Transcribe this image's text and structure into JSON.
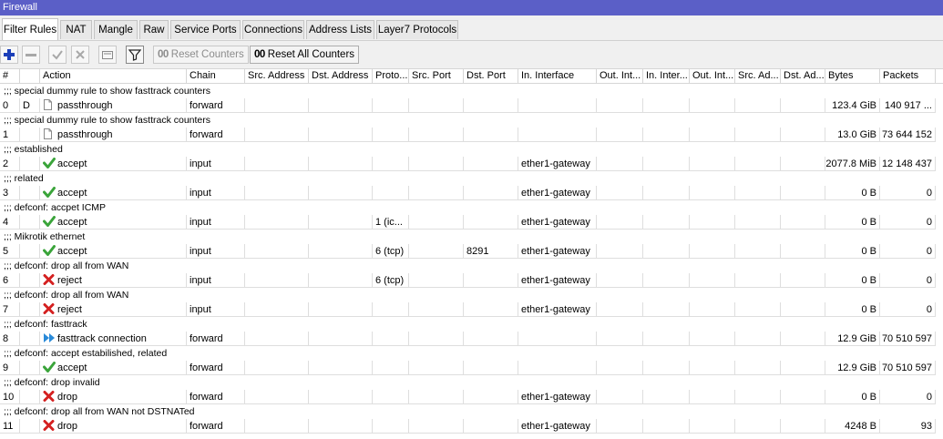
{
  "window": {
    "title": "Firewall"
  },
  "tabs": [
    {
      "label": "Filter Rules",
      "active": true
    },
    {
      "label": "NAT"
    },
    {
      "label": "Mangle"
    },
    {
      "label": "Raw"
    },
    {
      "label": "Service Ports"
    },
    {
      "label": "Connections"
    },
    {
      "label": "Address Lists"
    },
    {
      "label": "Layer7 Protocols"
    }
  ],
  "toolbar": {
    "reset_counters": "Reset Counters",
    "reset_all_counters": "Reset All Counters",
    "counter_badge": "00"
  },
  "columns": [
    "#",
    "",
    "Action",
    "Chain",
    "Src. Address",
    "Dst. Address",
    "Proto...",
    "Src. Port",
    "Dst. Port",
    "In. Interface",
    "Out. Int...",
    "In. Inter...",
    "Out. Int...",
    "Src. Ad...",
    "Dst. Ad...",
    "Bytes",
    "Packets"
  ],
  "colors": {
    "title_bar": "#5b5fc7",
    "accept": "#3aa43a",
    "reject": "#d42020",
    "fasttrack": "#2a8ad8"
  },
  "rows": [
    {
      "comment": ";;; special dummy rule to show fasttrack counters",
      "num": "0",
      "flag": "D",
      "action": "passthrough",
      "action_icon": "doc-icon",
      "chain": "forward",
      "src_address": "",
      "dst_address": "",
      "protocol": "",
      "src_port": "",
      "dst_port": "",
      "in_interface": "",
      "bytes": "123.4 GiB",
      "packets": "140 917 ..."
    },
    {
      "comment": ";;; special dummy rule to show fasttrack counters",
      "num": "1",
      "flag": "",
      "action": "passthrough",
      "action_icon": "doc-icon",
      "chain": "forward",
      "src_address": "",
      "dst_address": "",
      "protocol": "",
      "src_port": "",
      "dst_port": "",
      "in_interface": "",
      "bytes": "13.0 GiB",
      "packets": "73 644 152"
    },
    {
      "comment": ";;; established",
      "num": "2",
      "flag": "",
      "action": "accept",
      "action_icon": "check-icon",
      "chain": "input",
      "src_address": "",
      "dst_address": "",
      "protocol": "",
      "src_port": "",
      "dst_port": "",
      "in_interface": "ether1-gateway",
      "bytes": "2077.8 MiB",
      "packets": "12 148 437"
    },
    {
      "comment": ";;; related",
      "num": "3",
      "flag": "",
      "action": "accept",
      "action_icon": "check-icon",
      "chain": "input",
      "src_address": "",
      "dst_address": "",
      "protocol": "",
      "src_port": "",
      "dst_port": "",
      "in_interface": "ether1-gateway",
      "bytes": "0 B",
      "packets": "0"
    },
    {
      "comment": ";;; defconf: accpet ICMP",
      "num": "4",
      "flag": "",
      "action": "accept",
      "action_icon": "check-icon",
      "chain": "input",
      "src_address": "",
      "dst_address": "",
      "protocol": "1 (ic...",
      "src_port": "",
      "dst_port": "",
      "in_interface": "ether1-gateway",
      "bytes": "0 B",
      "packets": "0"
    },
    {
      "comment": ";;; Mikrotik ethernet",
      "num": "5",
      "flag": "",
      "action": "accept",
      "action_icon": "check-icon",
      "chain": "input",
      "src_address": "",
      "dst_address": "",
      "protocol": "6 (tcp)",
      "src_port": "",
      "dst_port": "8291",
      "in_interface": "ether1-gateway",
      "bytes": "0 B",
      "packets": "0"
    },
    {
      "comment": ";;; defconf: drop all from WAN",
      "num": "6",
      "flag": "",
      "action": "reject",
      "action_icon": "x-icon",
      "chain": "input",
      "src_address": "",
      "dst_address": "",
      "protocol": "6 (tcp)",
      "src_port": "",
      "dst_port": "",
      "in_interface": "ether1-gateway",
      "bytes": "0 B",
      "packets": "0"
    },
    {
      "comment": ";;; defconf: drop all from WAN",
      "num": "7",
      "flag": "",
      "action": "reject",
      "action_icon": "x-icon",
      "chain": "input",
      "src_address": "",
      "dst_address": "",
      "protocol": "",
      "src_port": "",
      "dst_port": "",
      "in_interface": "ether1-gateway",
      "bytes": "0 B",
      "packets": "0"
    },
    {
      "comment": ";;; defconf: fasttrack",
      "num": "8",
      "flag": "",
      "action": "fasttrack connection",
      "action_icon": "fasttrack-icon",
      "chain": "forward",
      "src_address": "",
      "dst_address": "",
      "protocol": "",
      "src_port": "",
      "dst_port": "",
      "in_interface": "",
      "bytes": "12.9 GiB",
      "packets": "70 510 597"
    },
    {
      "comment": ";;; defconf: accept estabilished, related",
      "num": "9",
      "flag": "",
      "action": "accept",
      "action_icon": "check-icon",
      "chain": "forward",
      "src_address": "",
      "dst_address": "",
      "protocol": "",
      "src_port": "",
      "dst_port": "",
      "in_interface": "",
      "bytes": "12.9 GiB",
      "packets": "70 510 597"
    },
    {
      "comment": ";;; defconf: drop invalid",
      "num": "10",
      "flag": "",
      "action": "drop",
      "action_icon": "x-icon",
      "chain": "forward",
      "src_address": "",
      "dst_address": "",
      "protocol": "",
      "src_port": "",
      "dst_port": "",
      "in_interface": "ether1-gateway",
      "bytes": "0 B",
      "packets": "0"
    },
    {
      "comment": ";;; defconf: drop all from WAN not DSTNATed",
      "num": "11",
      "flag": "",
      "action": "drop",
      "action_icon": "x-icon",
      "chain": "forward",
      "src_address": "",
      "dst_address": "",
      "protocol": "",
      "src_port": "",
      "dst_port": "",
      "in_interface": "ether1-gateway",
      "bytes": "4248 B",
      "packets": "93"
    }
  ]
}
